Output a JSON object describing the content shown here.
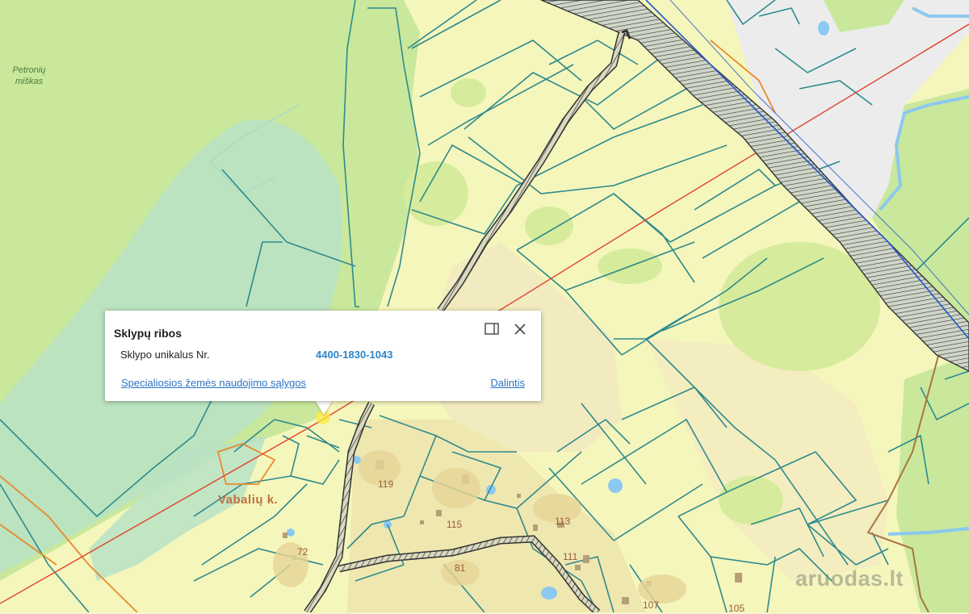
{
  "map": {
    "forest_name": "Petronių\nmiškas",
    "village_name": "Vabalių k.",
    "house_numbers": [
      "119",
      "115",
      "113",
      "111",
      "81",
      "72",
      "107",
      "105"
    ]
  },
  "popup": {
    "title": "Sklypų ribos",
    "field_label": "Sklypo unikalus Nr.",
    "field_value": "4400-1830-1043",
    "link_special": "Specialiosios žemės naudojimo sąlygos",
    "link_share": "Dalintis",
    "dock_icon": "dock-panel-icon",
    "close_icon": "close-icon"
  },
  "watermark": "aruodas.lt",
  "colors": {
    "forest": "#c8e89a",
    "wetland": "#b4e0c6",
    "farmland": "#f4f6b8",
    "parcel_border": "#2e8a8c",
    "road_red": "#e0422c",
    "boundary_orange": "#e8892e",
    "link_blue": "#2d74c4"
  }
}
